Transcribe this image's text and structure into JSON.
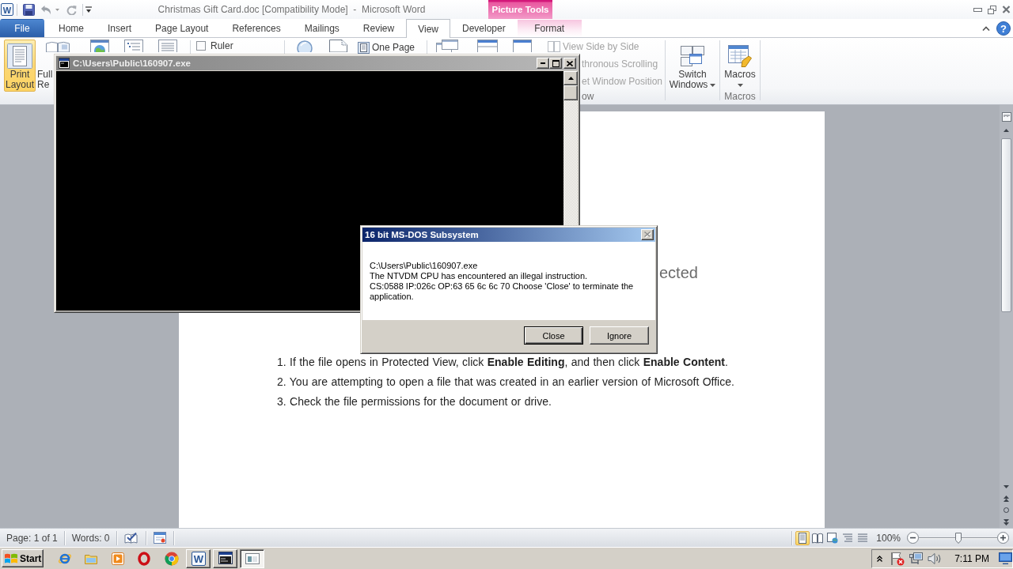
{
  "title_bar": {
    "app_icon": "W",
    "title": "Christmas Gift Card.doc [Compatibility Mode]  -  Microsoft Word",
    "contextual_group": "Picture Tools"
  },
  "tab_bar": {
    "tabs": [
      {
        "label": "File",
        "kind": "file",
        "selected": false
      },
      {
        "label": "Home",
        "kind": "tab",
        "selected": false
      },
      {
        "label": "Insert",
        "kind": "tab",
        "selected": false
      },
      {
        "label": "Page Layout",
        "kind": "tab",
        "selected": false
      },
      {
        "label": "References",
        "kind": "tab",
        "selected": false
      },
      {
        "label": "Mailings",
        "kind": "tab",
        "selected": false
      },
      {
        "label": "Review",
        "kind": "tab",
        "selected": false
      },
      {
        "label": "View",
        "kind": "tab",
        "selected": true
      },
      {
        "label": "Developer",
        "kind": "tab",
        "selected": false
      },
      {
        "label": "Format",
        "kind": "contextual",
        "selected": false
      }
    ],
    "help": "?"
  },
  "ribbon": {
    "document_views": [
      {
        "label": "Print Layout",
        "selected": true
      },
      {
        "label": "Full Re",
        "selected": false
      }
    ],
    "show": {
      "ruler": {
        "label": "Ruler",
        "checked": false
      }
    },
    "zoom": {
      "one_page": {
        "label": "One Page"
      }
    },
    "window": {
      "small_buttons": [
        {
          "label": "View Side by Side",
          "disabled": true
        },
        {
          "label": "thronous Scrolling",
          "disabled": true
        },
        {
          "label": "et Window Position",
          "disabled": true
        }
      ],
      "group_label": "ow",
      "switch_windows": {
        "label": "Switch Windows"
      }
    },
    "macros": {
      "button": {
        "label": "Macros"
      },
      "group_label": "Macros"
    }
  },
  "document": {
    "heading": "ected",
    "list": [
      "1. If the file opens in Protected View, click **Enable Editing**, and then click **Enable Content**.",
      "2. You are attempting to open a file that was created in an earlier version of Microsoft Office.",
      "3. Check the file permissions for the document or drive."
    ]
  },
  "status_bar": {
    "page": "Page: 1 of 1",
    "words": "Words: 0",
    "views": [
      {
        "kind": "print_layout",
        "selected": true
      },
      {
        "kind": "full_reading",
        "selected": false
      },
      {
        "kind": "web_layout",
        "selected": false
      },
      {
        "kind": "outline",
        "selected": false
      },
      {
        "kind": "draft",
        "selected": false
      }
    ],
    "zoom": "100%",
    "zoom_slider": {
      "level": 0.5
    }
  },
  "console_window": {
    "title": "C:\\Users\\Public\\160907.exe"
  },
  "dialog": {
    "title": "16 bit MS-DOS Subsystem",
    "close_button": {
      "disabled": true
    },
    "message": [
      "C:\\Users\\Public\\160907.exe",
      "The NTVDM CPU has encountered an illegal instruction.",
      "CS:0588 IP:026c OP:63 65 6c 6c 70 Choose 'Close' to terminate the application."
    ],
    "buttons": [
      {
        "label": "Close",
        "default": true
      },
      {
        "label": "Ignore",
        "default": false
      }
    ]
  },
  "taskbar": {
    "start": "Start",
    "tasks": [
      {
        "kind": "word",
        "icon_letter": "W",
        "selected": false
      },
      {
        "kind": "console",
        "selected": false
      },
      {
        "kind": "window",
        "selected": true
      }
    ],
    "clock": "7:11 PM"
  }
}
